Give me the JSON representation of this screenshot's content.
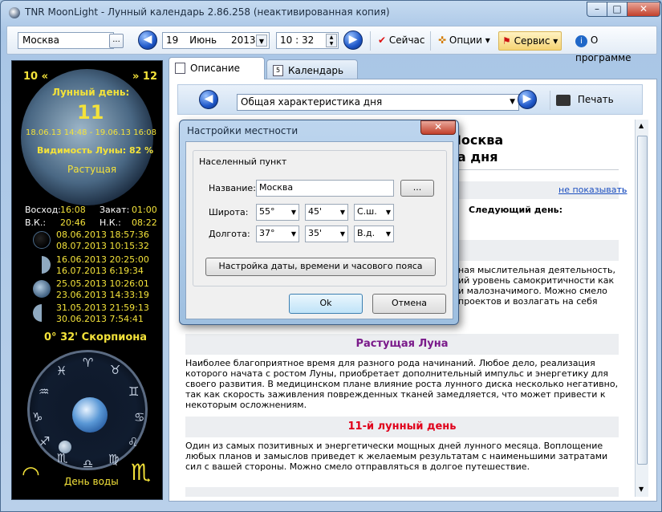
{
  "window": {
    "title": "TNR MoonLight - Лунный календарь 2.86.258 (неактивированная копия)"
  },
  "toolbar": {
    "city": "Москва",
    "city_btn": "...",
    "day": "19",
    "month": "Июнь",
    "year": "2013",
    "time": "10 : 32",
    "now_label": "Сейчас",
    "options_label": "Опции",
    "service_label": "Сервис",
    "about_label": "О программе"
  },
  "left_panel": {
    "prev_day": "10 «",
    "next_day": "» 12",
    "lunar_day_label": "Лунный день:",
    "lunar_day_number": "11",
    "lunar_day_range": "18.06.13 14:48 - 19.06.13 16:08",
    "visibility": "Видимость Луны: 82 %",
    "phase_name": "Растущая",
    "sunrise_label": "Восход:",
    "sunrise": "16:08",
    "sunset_label": "Закат:",
    "sunset": "01:00",
    "vk_label": "В.К.:",
    "vk": "20:46",
    "nk_label": "Н.К.:",
    "nk": "08:22",
    "phases": [
      {
        "d1": "08.06.2013 18:57:36",
        "d2": "08.07.2013 10:15:32"
      },
      {
        "d1": "16.06.2013 20:25:00",
        "d2": "16.07.2013 6:19:34"
      },
      {
        "d1": "25.05.2013 10:26:01",
        "d2": "23.06.2013 14:33:19"
      },
      {
        "d1": "31.05.2013 21:59:13",
        "d2": "30.06.2013 7:54:41"
      }
    ],
    "zodiac_position": "0° 32' Скорпиона",
    "element_day": "День воды"
  },
  "tabs": {
    "description": "Описание",
    "calendar": "Календарь"
  },
  "content": {
    "section_select": "Общая характеристика дня",
    "print_label": "Печать",
    "heading_line1": "Москва",
    "heading_line2": "ка дня",
    "hide_link": "не показывать",
    "next_day_label": "Следующий день:",
    "frag1": "ная мыслительная деятельность,",
    "frag2": "ий уровень самокритичности как",
    "frag3": "и малозначимого. Можно смело",
    "frag4": "проектов и возлагать на себя",
    "sect_growing": "Растущая Луна",
    "growing_text": "Наиболее благоприятное время для разного рода начинаний. Любое дело, реализация которого начата с ростом Луны, приобретает дополнительный импульс и энергетику для своего развития. В медицинском плане влияние роста лунного диска несколько негативно, так как скорость заживления поврежденных тканей замедляется, что может привести к некоторым осложнениям.",
    "sect_day11": "11-й лунный день",
    "day11_text": "Один из самых позитивных и энергетически мощных дней лунного месяца. Воплощение любых планов и замыслов приведет к желаемым результатам с наименьшими затратами сил с вашей стороны. Можно смело отправляться в долгое путешествие."
  },
  "dialog": {
    "title": "Настройки местности",
    "close": "✕",
    "group_label": "Населенный пункт",
    "name_label": "Название:",
    "name_value": "Москва",
    "browse_btn": "...",
    "lat_label": "Широта:",
    "lat_deg": "55°",
    "lat_min": "45'",
    "lat_dir": "С.ш.",
    "lon_label": "Долгота:",
    "lon_deg": "37°",
    "lon_min": "35'",
    "lon_dir": "В.д.",
    "datetime_btn": "Настройка даты, времени и часового пояса",
    "ok": "Ok",
    "cancel": "Отмена"
  },
  "colors": {
    "accent_yellow": "#f3e23a",
    "section_purple": "#7a1a8a",
    "section_red": "#e0001b"
  },
  "icons": [
    "app-icon",
    "arrow-left-icon",
    "arrow-right-icon",
    "check-icon",
    "options-icon",
    "flag-icon",
    "info-icon",
    "page-icon",
    "calendar-icon",
    "printer-icon"
  ]
}
